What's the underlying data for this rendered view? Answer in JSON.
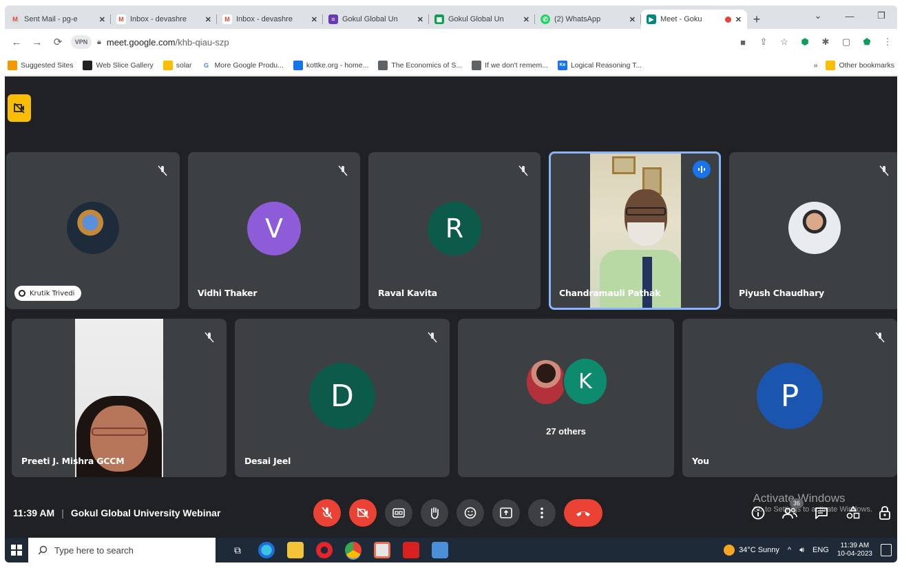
{
  "browser": {
    "tabs": [
      {
        "title": "Sent Mail - pg-e",
        "favicon_color": "#ffffff",
        "favicon": "gmail-icon"
      },
      {
        "title": "Inbox - devashre",
        "favicon_color": "#ea4335",
        "favicon": "gmail-icon"
      },
      {
        "title": "Inbox - devashre",
        "favicon_color": "#ea4335",
        "favicon": "gmail-icon"
      },
      {
        "title": "Gokul Global Un",
        "favicon_color": "#673ab7",
        "favicon": "forms-icon"
      },
      {
        "title": "Gokul Global Un",
        "favicon_color": "#0f9d58",
        "favicon": "sheets-icon"
      },
      {
        "title": "(2) WhatsApp",
        "favicon_color": "#25d366",
        "favicon": "whatsapp-icon"
      },
      {
        "title": "Meet - Goku",
        "favicon_color": "#00897b",
        "favicon": "meet-icon",
        "active": true
      }
    ],
    "url_host": "meet.google.com",
    "url_path": "/khb-qiau-szp",
    "vpn_label": "VPN",
    "bookmarks": [
      {
        "label": "Suggested Sites",
        "color": "#f29900"
      },
      {
        "label": "Web Slice Gallery",
        "color": "#202124"
      },
      {
        "label": "solar",
        "color": "#fbbc04"
      },
      {
        "label": "More Google Produ...",
        "color": "#4285f4"
      },
      {
        "label": "kottke.org - home...",
        "color": "#1a73e8"
      },
      {
        "label": "The Economics of S...",
        "color": "#5f6368"
      },
      {
        "label": "If we don't remem...",
        "color": "#5f6368"
      },
      {
        "label": "Logical Reasoning T...",
        "color": "#1a73e8"
      }
    ],
    "other_bookmarks": "Other bookmarks"
  },
  "meet": {
    "row1": [
      {
        "name": "Krutik Trivedi",
        "type": "photo-avatar",
        "avatar_color": "#2c3e50"
      },
      {
        "name": "Vidhi Thaker",
        "type": "letter",
        "letter": "V",
        "avatar_color": "#8e5cd9"
      },
      {
        "name": "Raval Kavita",
        "type": "letter",
        "letter": "R",
        "avatar_color": "#0b5a4a"
      },
      {
        "name": "Chandramauli Pathak",
        "type": "video",
        "speaking": true
      },
      {
        "name": "Piyush Chaudhary",
        "type": "photo-avatar",
        "avatar_color": "#c9d3d8"
      }
    ],
    "row2": [
      {
        "name": "Preeti J. Mishra GCCM",
        "type": "video"
      },
      {
        "name": "Desai Jeel",
        "type": "letter",
        "letter": "D",
        "avatar_color": "#0b5a4a"
      },
      {
        "name": "",
        "type": "others",
        "letter": "K",
        "avatar_color": "#0e8a6f",
        "others_label": "27 others"
      },
      {
        "name": "You",
        "type": "letter",
        "letter": "P",
        "avatar_color": "#1a56b0"
      }
    ],
    "time": "11:39 AM",
    "separator": "|",
    "meeting_title": "Gokul Global University Webinar",
    "participant_count": "36",
    "watermark_title": "Activate Windows",
    "watermark_sub": "Go to Settings to activate Windows."
  },
  "taskbar": {
    "search_placeholder": "Type here to search",
    "weather": "34°C  Sunny",
    "language": "ENG",
    "time": "11:39 AM",
    "date": "10-04-2023"
  }
}
